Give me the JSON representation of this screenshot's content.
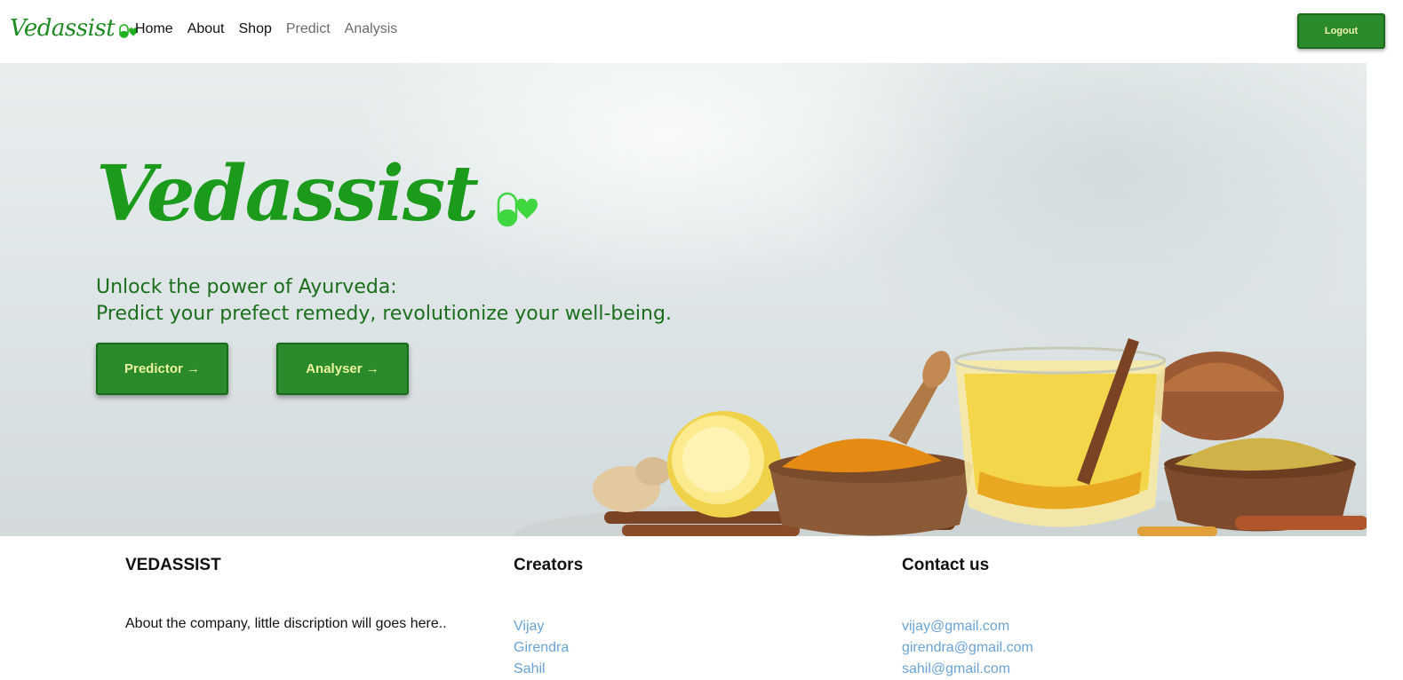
{
  "navbar": {
    "brand": "Vedassist",
    "links": [
      {
        "label": "Home"
      },
      {
        "label": "About"
      },
      {
        "label": "Shop"
      },
      {
        "label": "Predict"
      },
      {
        "label": "Analysis"
      }
    ],
    "logout_label": "Logout"
  },
  "hero": {
    "title": "Vedassist",
    "tagline_line1": "Unlock the power of Ayurveda:",
    "tagline_line2": "Predict your prefect remedy, revolutionize your well-being.",
    "predictor_label": "Predictor →",
    "analyser_label": "Analyser →"
  },
  "footer": {
    "company": {
      "heading": "VEDASSIST",
      "description": "About the company, little discription will goes here.."
    },
    "creators": {
      "heading": "Creators",
      "names": [
        "Vijay",
        "Girendra",
        "Sahil"
      ]
    },
    "contact": {
      "heading": "Contact us",
      "emails": [
        "vijay@gmail.com",
        "girendra@gmail.com",
        "sahil@gmail.com"
      ]
    }
  },
  "colors": {
    "brand_green": "#1e8a22",
    "button_green": "#2b8a2b",
    "button_text": "#ecf3a0",
    "link_blue": "#6aa4d6"
  },
  "icons": {
    "brand": "pill-heart-icon"
  }
}
